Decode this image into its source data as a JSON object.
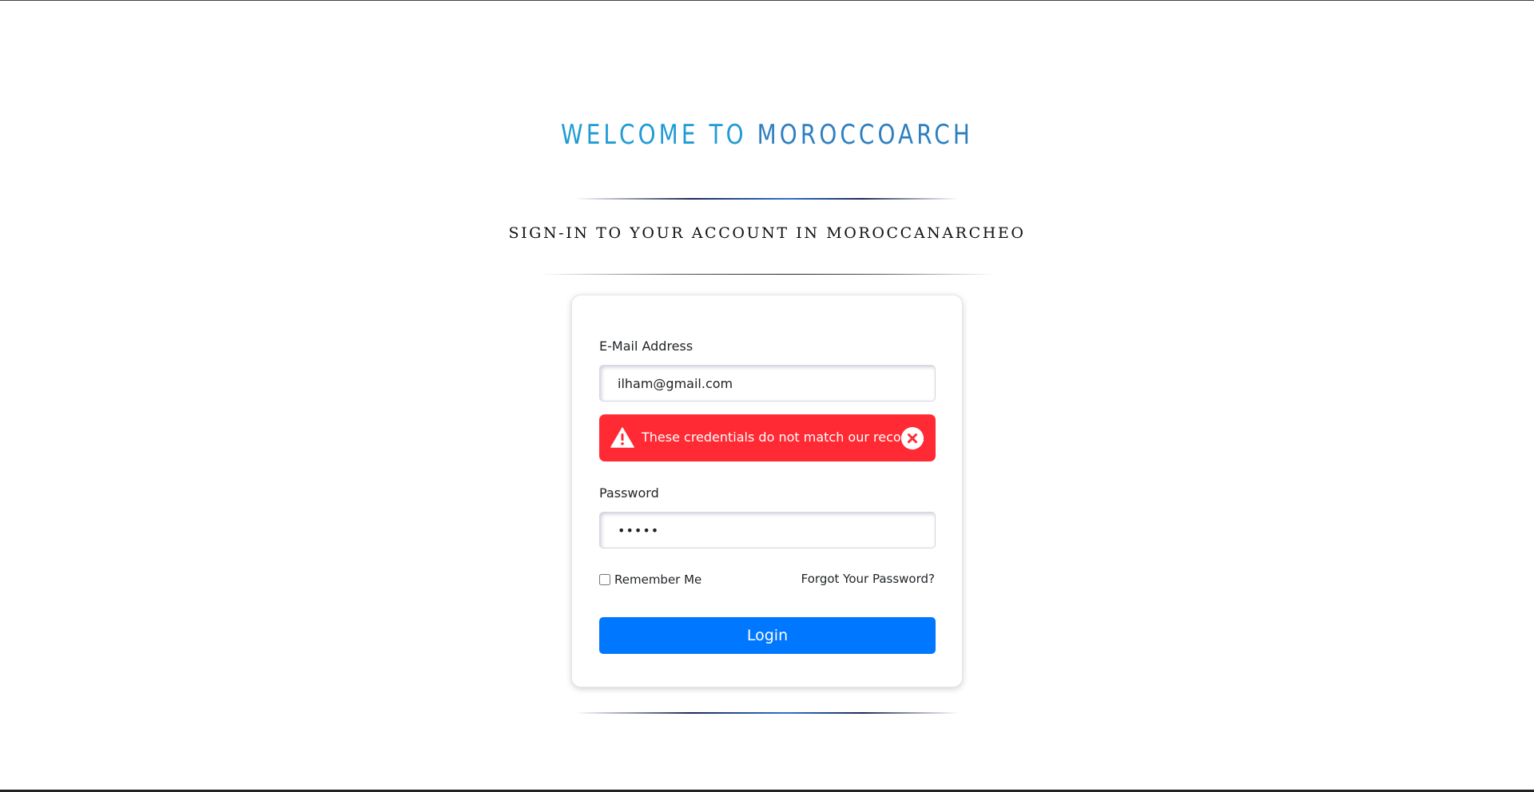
{
  "header": {
    "welcome_part1": "WELCOME TO ",
    "welcome_part2": "MOROCCOARCH",
    "subtitle": "SIGN-IN TO YOUR ACCOUNT IN MOROCCANARCHEO"
  },
  "form": {
    "email_label": "E-Mail Address",
    "email_value": "ilham@gmail.com",
    "error_message": "These credentials do not match our records.",
    "password_label": "Password",
    "password_value": "•••••",
    "remember_label": "Remember Me",
    "forgot_link": "Forgot Your Password?",
    "login_button": "Login"
  },
  "colors": {
    "title": "#2f88c8",
    "error": "#ff2a33",
    "button": "#0077ff"
  },
  "icons": {
    "alert": "warning-icon",
    "dismiss": "close-circle-icon"
  }
}
